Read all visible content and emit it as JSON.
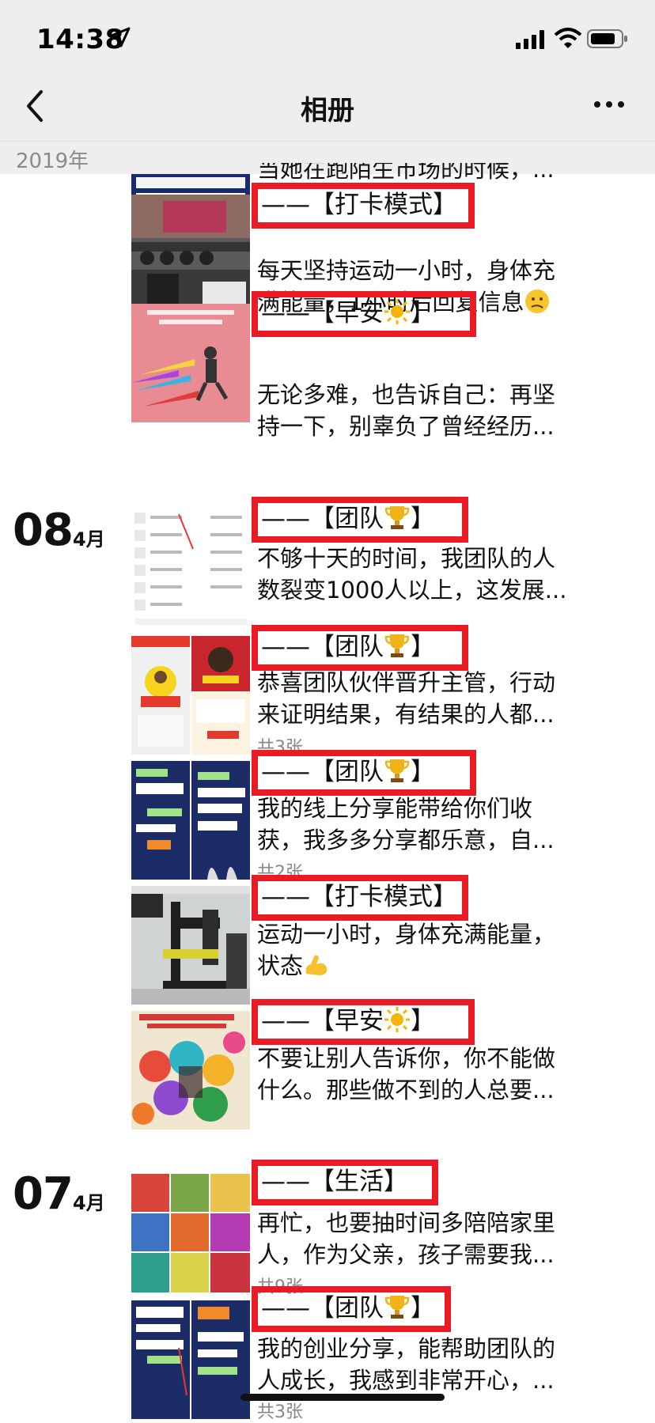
{
  "status": {
    "time": "14:38"
  },
  "nav": {
    "title": "相册"
  },
  "year_label": "2019年",
  "top_partial_text": "当她在跑陌生市场的时候，...",
  "sections": [
    {
      "day": "08",
      "month": "4月"
    },
    {
      "day": "07",
      "month": "4月"
    }
  ],
  "posts": [
    {
      "tag": "——【打卡模式】",
      "emoji": "",
      "line1": "每天坚持运动一小时，身体充",
      "line2": "满能量，1小时后回复信息",
      "count": ""
    },
    {
      "tag": "——【早安",
      "emoji": "sun-emoji",
      "tag_end": "】",
      "line1": "无论多难，也告诉自己：再坚",
      "line2": "持一下，别辜负了曾经经历...",
      "count": ""
    },
    {
      "tag": "——【团队",
      "emoji": "trophy-emoji",
      "tag_end": "】",
      "line1": "不够十天的时间，我团队的人",
      "line2": "数裂变1000人以上，这发展...",
      "count": ""
    },
    {
      "tag": "——【团队",
      "emoji": "trophy-emoji",
      "tag_end": "】",
      "line1": "恭喜团队伙伴晋升主管，行动",
      "line2": "来证明结果，有结果的人都...",
      "count": "共3张"
    },
    {
      "tag": "——【团队",
      "emoji": "trophy-emoji",
      "tag_end": "】",
      "line1": "我的线上分享能带给你们收",
      "line2": "获，我多多分享都乐意，自...",
      "count": "共2张"
    },
    {
      "tag": "——【打卡模式】",
      "emoji": "",
      "line1": "运动一小时，身体充满能量，",
      "line2": "状态",
      "count": ""
    },
    {
      "tag": "——【早安",
      "emoji": "sun-emoji",
      "tag_end": "】",
      "line1": "不要让别人告诉你，你不能做",
      "line2": "什么。那些做不到的人总要...",
      "count": ""
    },
    {
      "tag": "——【生活】",
      "emoji": "",
      "line1": "再忙，也要抽时间多陪陪家里",
      "line2": "人，作为父亲，孩子需要我...",
      "count": "共9张"
    },
    {
      "tag": "——【团队",
      "emoji": "trophy-emoji",
      "tag_end": "】",
      "line1": "我的创业分享，能帮助团队的",
      "line2": "人成长，我感到非常开心，...",
      "count": "共3张"
    }
  ]
}
